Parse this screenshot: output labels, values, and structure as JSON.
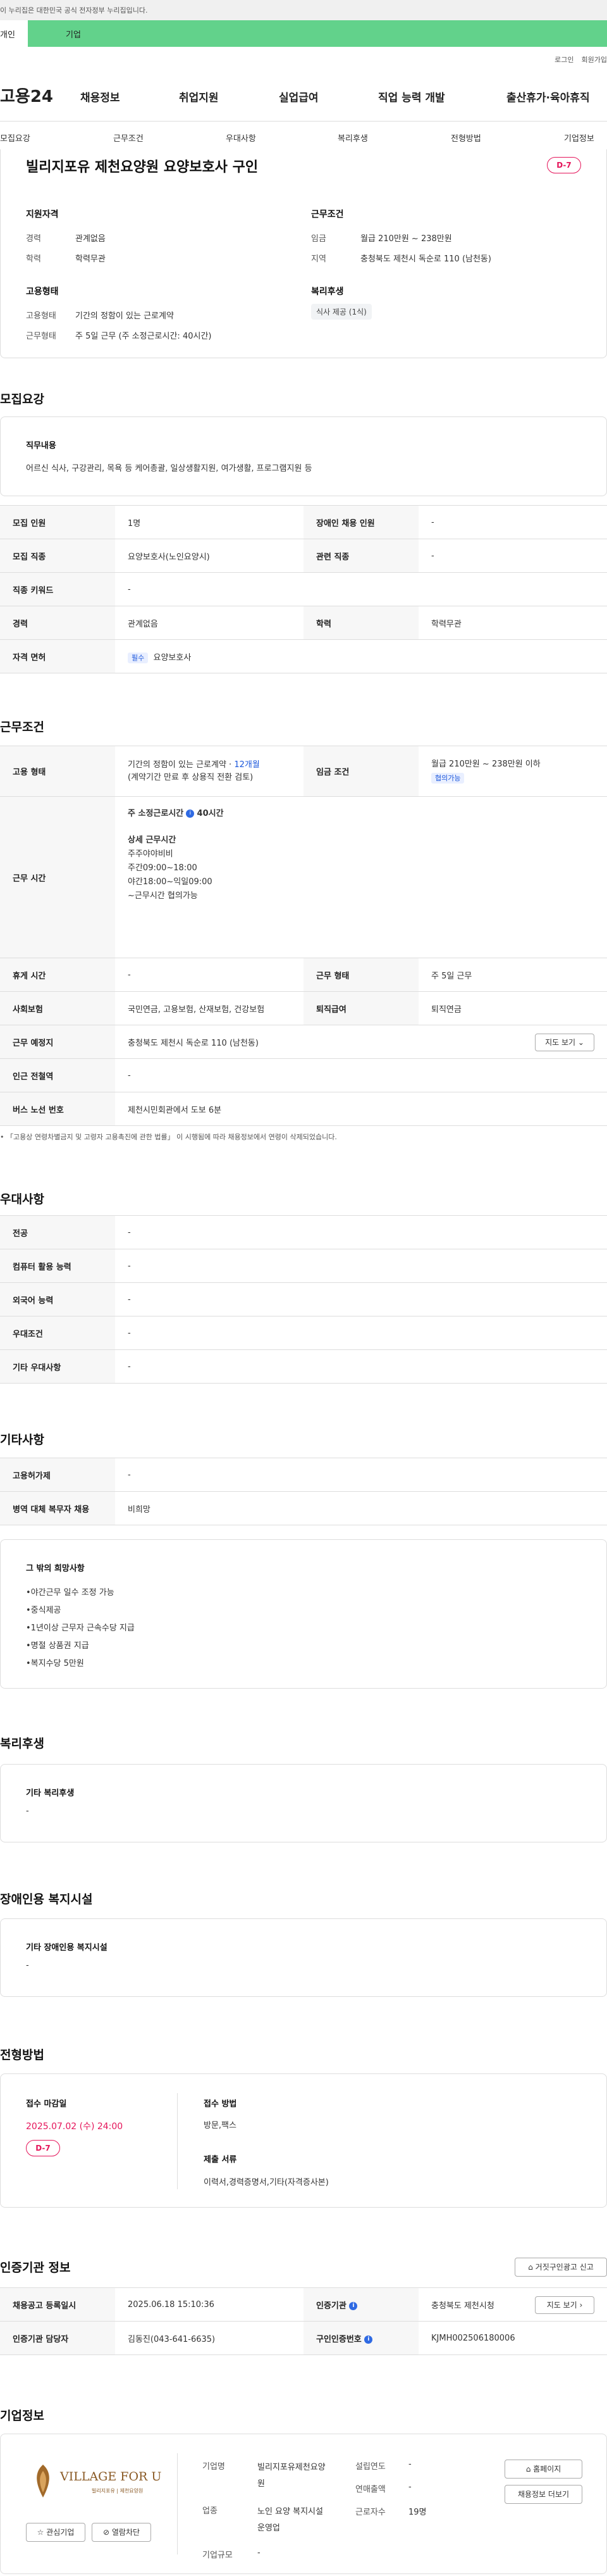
{
  "gov_banner": "이 누리집은 대한민국 공식 전자정부 누리집입니다.",
  "tabs": {
    "personal": "개인",
    "company": "기업"
  },
  "util_links": [
    "로그인",
    "회원가입"
  ],
  "logo": "고용24",
  "gnb": [
    "채용정보",
    "취업지원",
    "실업급여",
    "직업 능력 개발",
    "출산휴가·육아휴직"
  ],
  "subnav": [
    "모집요강",
    "근무조건",
    "우대사항",
    "복리후생",
    "전형방법",
    "기업정보"
  ],
  "job": {
    "title": "빌리지포유 제천요양원 요양보호사 구인",
    "dday": "D-7",
    "qual_title": "지원자격",
    "qual": [
      {
        "label": "경력",
        "value": "관계없음"
      },
      {
        "label": "학력",
        "value": "학력무관"
      }
    ],
    "cond_title": "근무조건",
    "cond": [
      {
        "label": "임금",
        "value": "월급 210만원 ~ 238만원"
      },
      {
        "label": "지역",
        "value": "충청북도 제천시 독순로 110 (남천동)"
      }
    ],
    "emp_title": "고용형태",
    "emp": [
      {
        "label": "고용형태",
        "value": "기간의 정함이 있는 근로계약"
      },
      {
        "label": "근무형태",
        "value": "주 5일 근무 (주 소정근로시간: 40시간)"
      }
    ],
    "welfare_title": "복리후생",
    "welfare_chip": "식사 제공 (1식)"
  },
  "recruit": {
    "heading": "모집요강",
    "duty_title": "직무내용",
    "duty_text": "어르신 식사, 구강관리, 목욕 등 케어총괄, 일상생활지원, 여가생활, 프로그램지원 등",
    "rows": {
      "count_l": "모집 인원",
      "count_v": "1명",
      "disabled_l": "장애인 채용 인원",
      "disabled_v": "-",
      "job_l": "모집 직종",
      "job_v": "요양보호사(노인요양시)",
      "rel_l": "관련 직종",
      "rel_v": "-",
      "kw_l": "직종 키워드",
      "kw_v": "-",
      "career_l": "경력",
      "career_v": "관계없음",
      "edu_l": "학력",
      "edu_v": "학력무관",
      "lic_l": "자격 면허",
      "lic_badge": "필수",
      "lic_v": "요양보호사"
    }
  },
  "work": {
    "heading": "근무조건",
    "type_l": "고용 형태",
    "type_v1": "기간의 정함이 있는 근로계약 · ",
    "type_months": "12개월",
    "type_v2": "(계약기간 만료 후 상용직 전환 검토)",
    "pay_l": "임금 조건",
    "pay_v": "월급 210만원 ~ 238만원 이하",
    "pay_badge": "협의가능",
    "hours_l": "근무 시간",
    "hours_main": "주 소정근로시간",
    "hours_val": "40시간",
    "hours_detail_title": "상세 근무시간",
    "hours_detail": [
      "주주야야비비",
      "주간09:00~18:00",
      "야간18:00~익일09:00",
      "~근무시간 협의가능"
    ],
    "holiday_l": "휴게 시간",
    "holiday_v": "-",
    "form_l": "근무 형태",
    "form_v": "주 5일 근무",
    "ins_l": "사회보험",
    "ins_v": "국민연금, 고용보험, 산재보험, 건강보험",
    "ret_l": "퇴직급여",
    "ret_v": "퇴직연금",
    "place_l": "근무 예정지",
    "place_v": "충청북도 제천시 독순로 110 (남천동)",
    "map_btn": "지도 보기",
    "station_l": "인근 전철역",
    "station_v": "-",
    "bus_l": "버스 노선 번호",
    "bus_v": "제천시민회관에서 도보 6분",
    "note": "「고용상 연령차별금지 및 고령자 고용촉진에 관한 법률」 이 시행됨에 따라 채용정보에서 연령이 삭제되었습니다."
  },
  "pref": {
    "heading": "우대사항",
    "rows": [
      {
        "label": "전공",
        "value": "-"
      },
      {
        "label": "컴퓨터 활용 능력",
        "value": "-"
      },
      {
        "label": "외국어 능력",
        "value": "-"
      },
      {
        "label": "우대조건",
        "value": "-"
      },
      {
        "label": "기타 우대사항",
        "value": "-"
      }
    ]
  },
  "etc": {
    "heading": "기타사항",
    "rows": [
      {
        "label": "고용허가제",
        "value": "-"
      },
      {
        "label": "병역 대체 복무자 채용",
        "value": "비희망"
      }
    ],
    "hope_title": "그 밖의 희망사항",
    "hope": [
      "•야간근무 일수 조정 가능",
      "•중식제공",
      "•1년이상 근무자 근속수당 지급",
      "•명절 상품권 지급",
      "•복지수당 5만원"
    ]
  },
  "welfare": {
    "heading": "복리후생",
    "title": "기타 복리후생",
    "value": "-"
  },
  "facility": {
    "heading": "장애인용 복지시설",
    "title": "기타 장애인용 복지시설",
    "value": "-"
  },
  "screen": {
    "heading": "전형방법",
    "deadline_l": "접수 마감일",
    "deadline_v": "2025.07.02 (수) 24:00",
    "dday": "D-7",
    "method_l": "접수 방법",
    "method_v": "방문,팩스",
    "docs_l": "제출 서류",
    "docs_v": "이력서,경력증명서,기타(자격증사본)"
  },
  "cert": {
    "heading": "인증기관 정보",
    "report_btn": "거짓구인광고 신고",
    "reg_l": "채용공고 등록일시",
    "reg_v": "2025.06.18 15:10:36",
    "org_l": "인증기관",
    "org_v": "충청북도 제천시청",
    "map_btn": "지도 보기",
    "mgr_l": "인증기관 담당자",
    "mgr_v": "김동진(043-641-6635)",
    "id_l": "구인인증번호",
    "id_v": "KJMH002506180006"
  },
  "company": {
    "heading": "기업정보",
    "logo_text": "VILLAGE FOR U",
    "logo_sub": "빌리지포유 | 제천요양원",
    "fav_btn": "관심기업",
    "block_btn": "열람차단",
    "name_l": "기업명",
    "name_v": "빌리지포유제천요양원",
    "ind_l": "업종",
    "ind_v": "노인 요양 복지시설 운영업",
    "size_l": "기업규모",
    "size_v": "-",
    "est_l": "설립연도",
    "est_v": "-",
    "sales_l": "연매출액",
    "sales_v": "-",
    "emp_l": "근로자수",
    "emp_v": "19명",
    "home_btn": "홈페이지",
    "more_btn": "채용정보 더보기"
  }
}
